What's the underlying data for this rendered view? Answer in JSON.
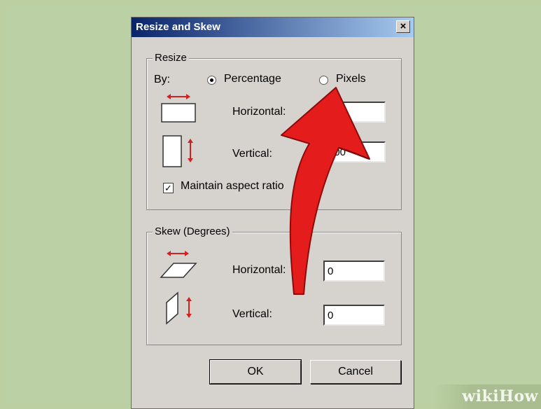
{
  "dialog": {
    "title": "Resize and Skew",
    "close_glyph": "×"
  },
  "resize": {
    "group_label": "Resize",
    "by_label": "By:",
    "percentage_label": "Percentage",
    "pixels_label": "Pixels",
    "selected": "Percentage",
    "horizontal_label": "Horizontal:",
    "horizontal_value": "",
    "vertical_label": "Vertical:",
    "vertical_value": "100",
    "maintain_label": "Maintain aspect ratio",
    "maintain_checked": true,
    "check_glyph": "✓"
  },
  "skew": {
    "group_label": "Skew (Degrees)",
    "horizontal_label": "Horizontal:",
    "horizontal_value": "0",
    "vertical_label": "Vertical:",
    "vertical_value": "0"
  },
  "buttons": {
    "ok": "OK",
    "cancel": "Cancel"
  },
  "watermark": {
    "wiki": "wiki",
    "how": "How"
  },
  "colors": {
    "background": "#bbd0a4",
    "dialog_face": "#d6d3ce",
    "title_gradient_start": "#0a246a",
    "annotation_arrow": "#e51c1c",
    "icon_arrow": "#d62020"
  }
}
